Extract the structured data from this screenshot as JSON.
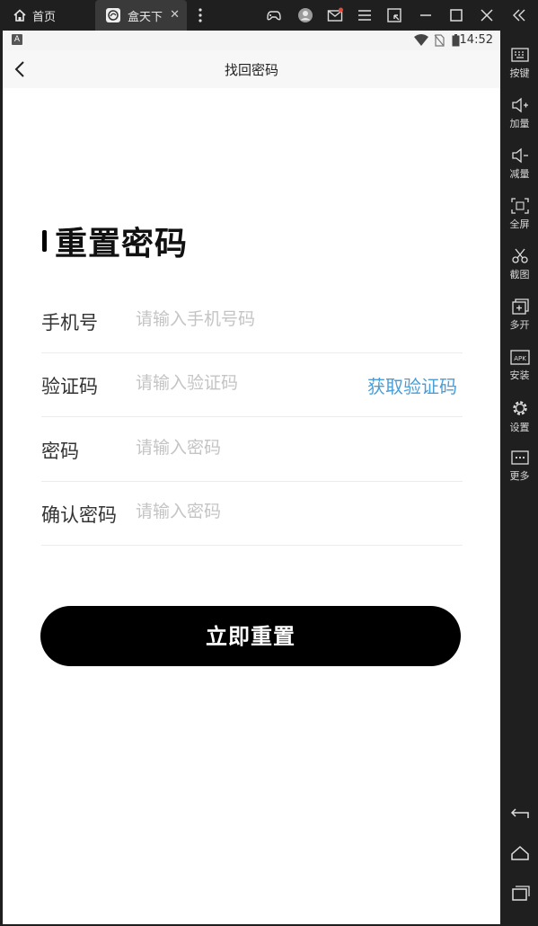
{
  "emulator": {
    "home_tab": "首页",
    "app_tab": "盒天下",
    "tab_close": "✕",
    "sidebar": [
      {
        "label": "按键",
        "icon": "keyboard-icon"
      },
      {
        "label": "加量",
        "icon": "volume-up-icon"
      },
      {
        "label": "减量",
        "icon": "volume-down-icon"
      },
      {
        "label": "全屏",
        "icon": "fullscreen-icon"
      },
      {
        "label": "截图",
        "icon": "scissors-icon"
      },
      {
        "label": "多开",
        "icon": "multi-instance-icon"
      },
      {
        "label": "安装",
        "icon": "apk-install-icon"
      },
      {
        "label": "设置",
        "icon": "gear-icon"
      },
      {
        "label": "更多",
        "icon": "more-icon"
      }
    ],
    "sb_apk_text": "APK"
  },
  "status_bar": {
    "a_badge": "A",
    "time": "14:52"
  },
  "nav": {
    "title": "找回密码"
  },
  "page": {
    "heading": "重置密码",
    "fields": [
      {
        "label": "手机号",
        "placeholder": "请输入手机号码"
      },
      {
        "label": "验证码",
        "placeholder": "请输入验证码"
      },
      {
        "label": "密码",
        "placeholder": "请输入密码"
      },
      {
        "label": "确认密码",
        "placeholder": "请输入密码"
      }
    ],
    "get_code": "获取验证码",
    "submit": "立即重置"
  },
  "colors": {
    "accent_link": "#4a9ed8",
    "button_bg": "#000000",
    "chrome": "#1f1f1f"
  }
}
